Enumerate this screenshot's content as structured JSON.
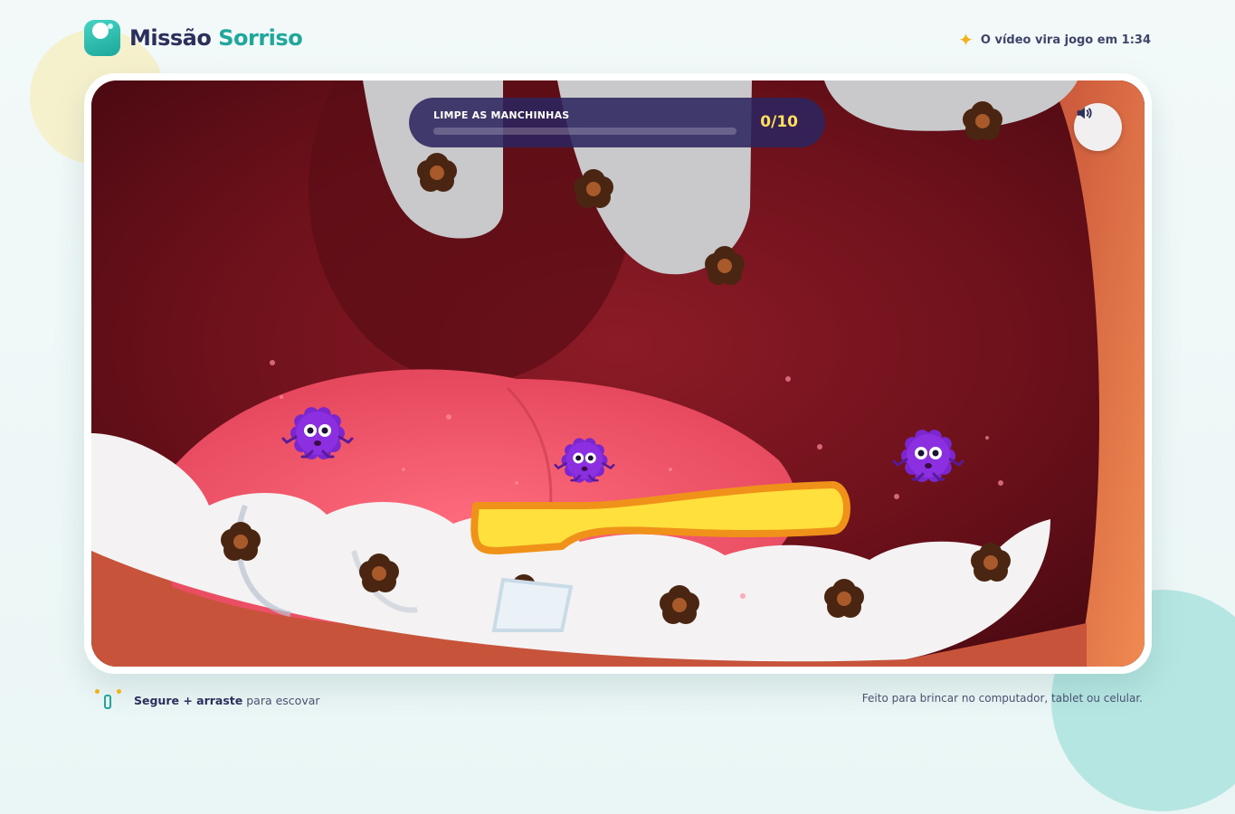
{
  "brand": {
    "name_part1": "Missão",
    "name_part2": "Sorriso"
  },
  "header": {
    "timer_text": "O vídeo vira jogo em 1:34"
  },
  "hud": {
    "title": "LIMPE AS MANCHINHAS",
    "cleaned": 0,
    "total": 10,
    "score_text": "0/10",
    "progress_fraction": 0
  },
  "sound": {
    "label": "Som"
  },
  "footer": {
    "hint_strong": "Segure + arraste",
    "hint_rest": " para escovar",
    "note": "Feito para brincar no computador, tablet ou celular."
  },
  "icons": {
    "timer": "sparkle-icon",
    "sound": "speaker-icon",
    "hint": "touch-drag-icon"
  },
  "colors": {
    "brand_dark": "#2c2f5b",
    "brand_teal": "#1ea79a",
    "accent_yellow": "#f2b21f",
    "mouth_red": "#7c1520",
    "stain_brown": "#6b3a1e",
    "germ_purple": "#8b2fe0",
    "toothbrush_yellow": "#ffe03c"
  }
}
